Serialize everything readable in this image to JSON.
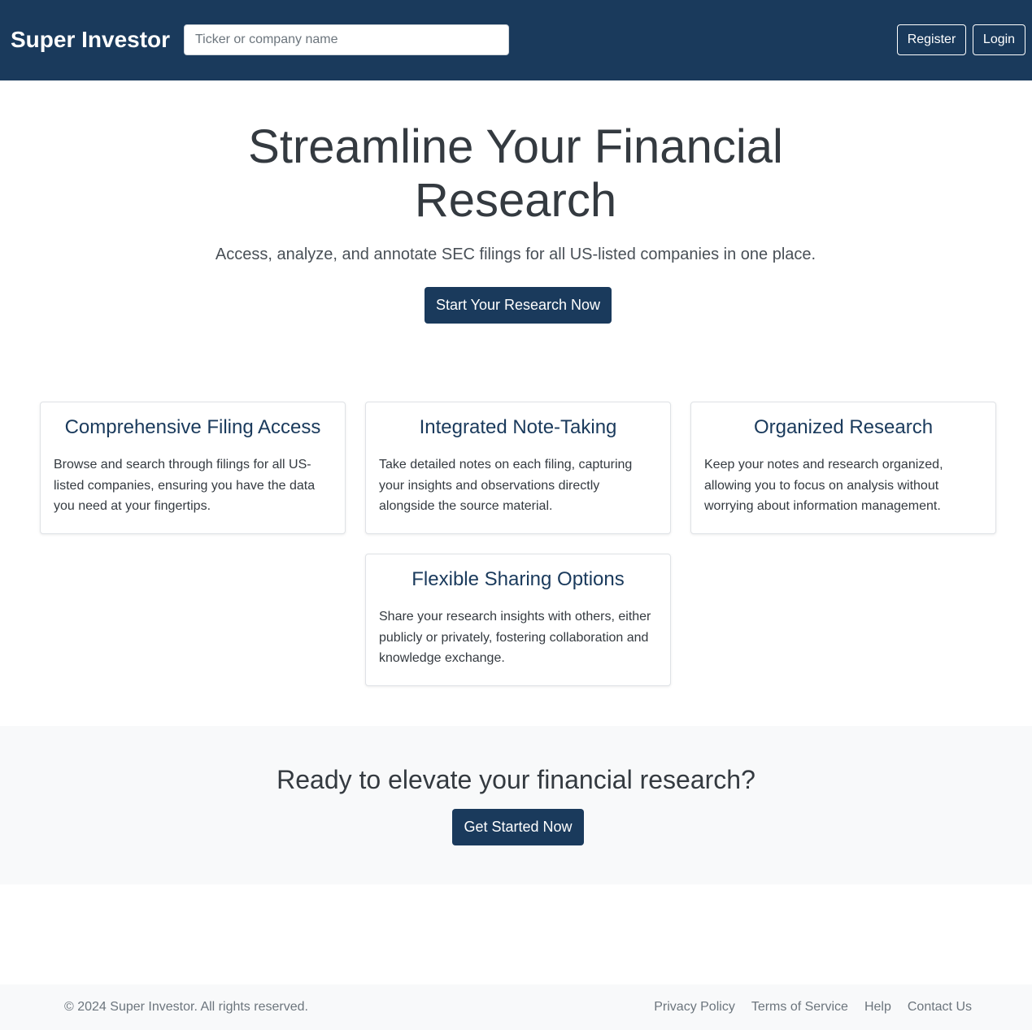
{
  "navbar": {
    "brand": "Super Investor",
    "search_placeholder": "Ticker or company name",
    "register_label": "Register",
    "login_label": "Login"
  },
  "hero": {
    "title_line1": "Streamline Your Financial",
    "title_line2": "Research",
    "subtitle": "Access, analyze, and annotate SEC filings for all US-listed companies in one place.",
    "cta_label": "Start Your Research Now"
  },
  "features": [
    {
      "title": "Comprehensive Filing Access",
      "body": "Browse and search through filings for all US-listed companies, ensuring you have the data you need at your fingertips."
    },
    {
      "title": "Integrated Note-Taking",
      "body": "Take detailed notes on each filing, capturing your insights and observations directly alongside the source material."
    },
    {
      "title": "Organized Research",
      "body": "Keep your notes and research organized, allowing you to focus on analysis without worrying about information management."
    },
    {
      "title": "Flexible Sharing Options",
      "body": "Share your research insights with others, either publicly or privately, fostering collaboration and knowledge exchange."
    }
  ],
  "cta": {
    "heading": "Ready to elevate your financial research?",
    "button_label": "Get Started Now"
  },
  "footer": {
    "copyright": "© 2024 Super Investor. All rights reserved.",
    "links": [
      "Privacy Policy",
      "Terms of Service",
      "Help",
      "Contact Us"
    ]
  },
  "colors": {
    "primary": "#1a3a5c",
    "light_bg": "#f8f9fa"
  }
}
